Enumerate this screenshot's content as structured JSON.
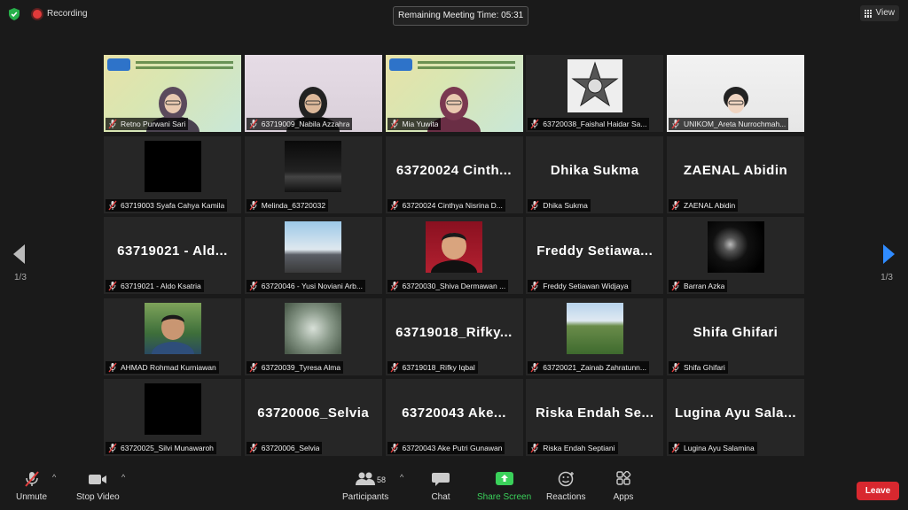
{
  "topbar": {
    "recording_label": "Recording",
    "timer": "Remaining Meeting Time: 05:31",
    "view_label": "View"
  },
  "pager": {
    "left": "1/3",
    "right": "1/3"
  },
  "tiles": [
    {
      "name": "Retno Purwani Sari",
      "big": "",
      "type": "video-slide"
    },
    {
      "name": "63719009_Nabila Azzahra",
      "big": "",
      "type": "video-room"
    },
    {
      "name": "Mia Yuwita",
      "big": "",
      "type": "video-slide-active"
    },
    {
      "name": "63720038_Faishal Haidar Sa...",
      "big": "",
      "type": "thumb-mandala"
    },
    {
      "name": "UNIKOM_Areta Nurrochmah...",
      "big": "",
      "type": "video-white"
    },
    {
      "name": "63719003 Syafa Cahya Kamila",
      "big": "",
      "type": "thumb-black"
    },
    {
      "name": "Melinda_63720032",
      "big": "",
      "type": "thumb-stage"
    },
    {
      "name": "63720024 Cinthya Nisrina D...",
      "big": "63720024 Cinth...",
      "type": "text"
    },
    {
      "name": "Dhika Sukma",
      "big": "Dhika Sukma",
      "type": "text"
    },
    {
      "name": "ZAENAL Abidin",
      "big": "ZAENAL Abidin",
      "type": "text"
    },
    {
      "name": "63719021 - Aldo Ksatria",
      "big": "63719021 - Ald...",
      "type": "text"
    },
    {
      "name": "63720046 - Yusi Noviani Arb...",
      "big": "",
      "type": "thumb-sky"
    },
    {
      "name": "63720030_Shiva Dermawan ...",
      "big": "",
      "type": "thumb-red"
    },
    {
      "name": "Freddy Setiawan Widjaya",
      "big": "Freddy Setiawa...",
      "type": "text"
    },
    {
      "name": "Barran Azka",
      "big": "",
      "type": "thumb-night"
    },
    {
      "name": "AHMAD Rohmad Kurniawan",
      "big": "",
      "type": "thumb-boy"
    },
    {
      "name": "63720039_Tyresa Alma",
      "big": "",
      "type": "thumb-tree"
    },
    {
      "name": "63719018_Rifky Iqbal",
      "big": "63719018_Rifky...",
      "type": "text"
    },
    {
      "name": "63720021_Zainab Zahratunn...",
      "big": "",
      "type": "thumb-landscape"
    },
    {
      "name": "Shifa Ghifari",
      "big": "Shifa Ghifari",
      "type": "text"
    },
    {
      "name": "63720025_Silvi Munawaroh",
      "big": "",
      "type": "thumb-black"
    },
    {
      "name": "63720006_Selvia",
      "big": "63720006_Selvia",
      "type": "text"
    },
    {
      "name": "63720043 Ake Putri Gunawan",
      "big": "63720043 Ake...",
      "type": "text"
    },
    {
      "name": "Riska Endah Septiani",
      "big": "Riska Endah Se...",
      "type": "text"
    },
    {
      "name": "Lugina Ayu Salamina",
      "big": "Lugina Ayu Sala...",
      "type": "text"
    }
  ],
  "toolbar": {
    "unmute": "Unmute",
    "stop_video": "Stop Video",
    "participants": "Participants",
    "participants_count": "58",
    "chat": "Chat",
    "share_screen": "Share Screen",
    "reactions": "Reactions",
    "apps": "Apps",
    "leave": "Leave"
  },
  "colors": {
    "background": "#1a1a1a",
    "tile": "#262626",
    "active_border": "#d9e06a",
    "share_green": "#3ad15a",
    "leave_red": "#d8282f",
    "pager_blue": "#2f8bff",
    "muted_red": "#e23d3d"
  }
}
